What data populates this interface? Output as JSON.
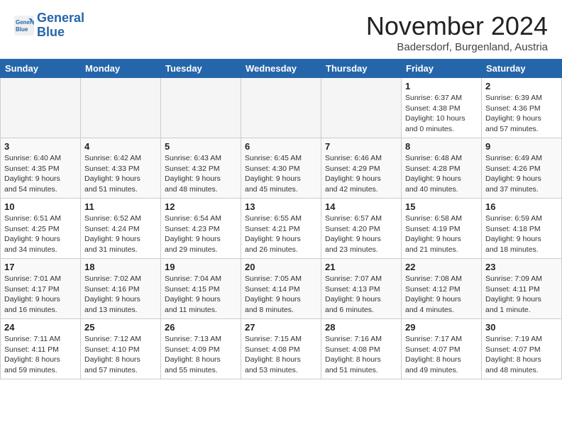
{
  "header": {
    "logo_line1": "General",
    "logo_line2": "Blue",
    "month": "November 2024",
    "location": "Badersdorf, Burgenland, Austria"
  },
  "weekdays": [
    "Sunday",
    "Monday",
    "Tuesday",
    "Wednesday",
    "Thursday",
    "Friday",
    "Saturday"
  ],
  "weeks": [
    [
      {
        "num": "",
        "info": ""
      },
      {
        "num": "",
        "info": ""
      },
      {
        "num": "",
        "info": ""
      },
      {
        "num": "",
        "info": ""
      },
      {
        "num": "",
        "info": ""
      },
      {
        "num": "1",
        "info": "Sunrise: 6:37 AM\nSunset: 4:38 PM\nDaylight: 10 hours\nand 0 minutes."
      },
      {
        "num": "2",
        "info": "Sunrise: 6:39 AM\nSunset: 4:36 PM\nDaylight: 9 hours\nand 57 minutes."
      }
    ],
    [
      {
        "num": "3",
        "info": "Sunrise: 6:40 AM\nSunset: 4:35 PM\nDaylight: 9 hours\nand 54 minutes."
      },
      {
        "num": "4",
        "info": "Sunrise: 6:42 AM\nSunset: 4:33 PM\nDaylight: 9 hours\nand 51 minutes."
      },
      {
        "num": "5",
        "info": "Sunrise: 6:43 AM\nSunset: 4:32 PM\nDaylight: 9 hours\nand 48 minutes."
      },
      {
        "num": "6",
        "info": "Sunrise: 6:45 AM\nSunset: 4:30 PM\nDaylight: 9 hours\nand 45 minutes."
      },
      {
        "num": "7",
        "info": "Sunrise: 6:46 AM\nSunset: 4:29 PM\nDaylight: 9 hours\nand 42 minutes."
      },
      {
        "num": "8",
        "info": "Sunrise: 6:48 AM\nSunset: 4:28 PM\nDaylight: 9 hours\nand 40 minutes."
      },
      {
        "num": "9",
        "info": "Sunrise: 6:49 AM\nSunset: 4:26 PM\nDaylight: 9 hours\nand 37 minutes."
      }
    ],
    [
      {
        "num": "10",
        "info": "Sunrise: 6:51 AM\nSunset: 4:25 PM\nDaylight: 9 hours\nand 34 minutes."
      },
      {
        "num": "11",
        "info": "Sunrise: 6:52 AM\nSunset: 4:24 PM\nDaylight: 9 hours\nand 31 minutes."
      },
      {
        "num": "12",
        "info": "Sunrise: 6:54 AM\nSunset: 4:23 PM\nDaylight: 9 hours\nand 29 minutes."
      },
      {
        "num": "13",
        "info": "Sunrise: 6:55 AM\nSunset: 4:21 PM\nDaylight: 9 hours\nand 26 minutes."
      },
      {
        "num": "14",
        "info": "Sunrise: 6:57 AM\nSunset: 4:20 PM\nDaylight: 9 hours\nand 23 minutes."
      },
      {
        "num": "15",
        "info": "Sunrise: 6:58 AM\nSunset: 4:19 PM\nDaylight: 9 hours\nand 21 minutes."
      },
      {
        "num": "16",
        "info": "Sunrise: 6:59 AM\nSunset: 4:18 PM\nDaylight: 9 hours\nand 18 minutes."
      }
    ],
    [
      {
        "num": "17",
        "info": "Sunrise: 7:01 AM\nSunset: 4:17 PM\nDaylight: 9 hours\nand 16 minutes."
      },
      {
        "num": "18",
        "info": "Sunrise: 7:02 AM\nSunset: 4:16 PM\nDaylight: 9 hours\nand 13 minutes."
      },
      {
        "num": "19",
        "info": "Sunrise: 7:04 AM\nSunset: 4:15 PM\nDaylight: 9 hours\nand 11 minutes."
      },
      {
        "num": "20",
        "info": "Sunrise: 7:05 AM\nSunset: 4:14 PM\nDaylight: 9 hours\nand 8 minutes."
      },
      {
        "num": "21",
        "info": "Sunrise: 7:07 AM\nSunset: 4:13 PM\nDaylight: 9 hours\nand 6 minutes."
      },
      {
        "num": "22",
        "info": "Sunrise: 7:08 AM\nSunset: 4:12 PM\nDaylight: 9 hours\nand 4 minutes."
      },
      {
        "num": "23",
        "info": "Sunrise: 7:09 AM\nSunset: 4:11 PM\nDaylight: 9 hours\nand 1 minute."
      }
    ],
    [
      {
        "num": "24",
        "info": "Sunrise: 7:11 AM\nSunset: 4:11 PM\nDaylight: 8 hours\nand 59 minutes."
      },
      {
        "num": "25",
        "info": "Sunrise: 7:12 AM\nSunset: 4:10 PM\nDaylight: 8 hours\nand 57 minutes."
      },
      {
        "num": "26",
        "info": "Sunrise: 7:13 AM\nSunset: 4:09 PM\nDaylight: 8 hours\nand 55 minutes."
      },
      {
        "num": "27",
        "info": "Sunrise: 7:15 AM\nSunset: 4:08 PM\nDaylight: 8 hours\nand 53 minutes."
      },
      {
        "num": "28",
        "info": "Sunrise: 7:16 AM\nSunset: 4:08 PM\nDaylight: 8 hours\nand 51 minutes."
      },
      {
        "num": "29",
        "info": "Sunrise: 7:17 AM\nSunset: 4:07 PM\nDaylight: 8 hours\nand 49 minutes."
      },
      {
        "num": "30",
        "info": "Sunrise: 7:19 AM\nSunset: 4:07 PM\nDaylight: 8 hours\nand 48 minutes."
      }
    ]
  ]
}
